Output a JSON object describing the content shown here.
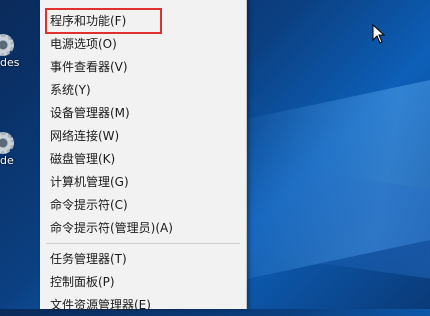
{
  "desktop": {
    "icons": [
      {
        "label": "des"
      },
      {
        "label": "de"
      }
    ]
  },
  "context_menu": {
    "items": [
      {
        "label": "程序和功能(F)",
        "highlighted": true
      },
      {
        "label": "电源选项(O)"
      },
      {
        "label": "事件查看器(V)"
      },
      {
        "label": "系统(Y)"
      },
      {
        "label": "设备管理器(M)"
      },
      {
        "label": "网络连接(W)"
      },
      {
        "label": "磁盘管理(K)"
      },
      {
        "label": "计算机管理(G)"
      },
      {
        "label": "命令提示符(C)"
      },
      {
        "label": "命令提示符(管理员)(A)"
      },
      {
        "label": "任务管理器(T)"
      },
      {
        "label": "控制面板(P)"
      },
      {
        "label": "文件资源管理器(E)"
      }
    ]
  },
  "colors": {
    "highlight_border": "#e03030",
    "menu_background": "#f2f2f2"
  }
}
